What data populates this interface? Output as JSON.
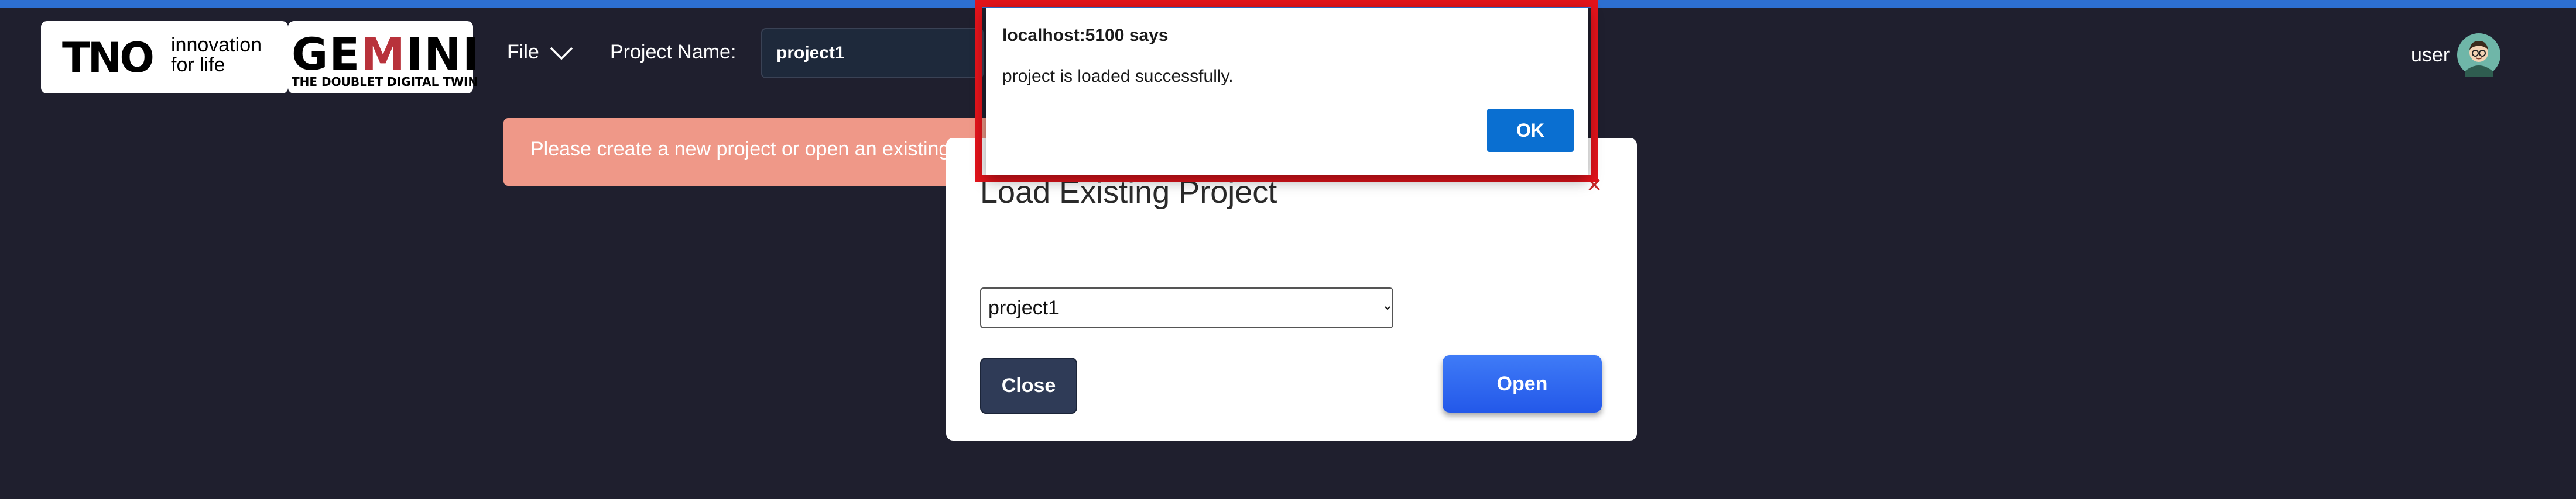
{
  "header": {
    "tno_logo": {
      "brand": "TNO",
      "tagline": [
        "innovation",
        "for life"
      ]
    },
    "gemini_logo": {
      "brand": "GEMINI",
      "tagline": "THE DOUBLET DIGITAL TWIN"
    },
    "file_menu_label": "File",
    "project_name_label": "Project Name:",
    "project_name_value": "project1",
    "user_name": "user"
  },
  "alert_banner": {
    "text": "Please create a new project or open an existing",
    "background": "#ef9888"
  },
  "load_modal": {
    "title": "Load Existing Project",
    "close_icon": "×",
    "select_options": [
      "project1"
    ],
    "selected_project": "project1",
    "close_button": "Close",
    "open_button": "Open"
  },
  "browser_dialog": {
    "title": "localhost:5100 says",
    "message": "project is loaded successfully.",
    "ok_button": "OK"
  },
  "colors": {
    "page_background": "#1f1f2e",
    "top_accent": "#2d6fd1",
    "open_button": "#2f66f0",
    "dialog_ok": "#0a6fd1",
    "highlight_frame": "#e3131b"
  }
}
